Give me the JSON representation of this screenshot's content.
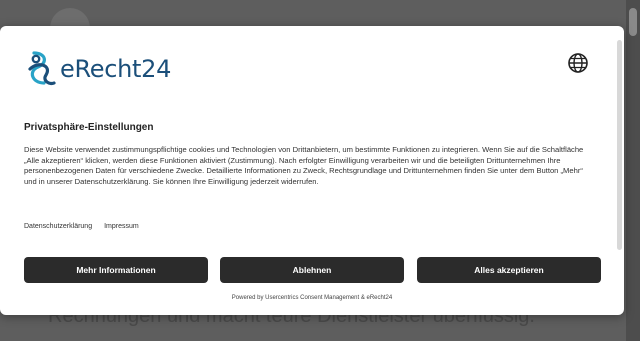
{
  "background": {
    "partial_text": "Rechnungen und macht teure Dienstleister überflüssig."
  },
  "modal": {
    "logo_text": "eRecht24",
    "language_icon": "globe-icon",
    "title": "Privatsphäre-Einstellungen",
    "description": "Diese Website verwendet zustimmungspflichtige cookies und Technologien von Drittanbietern, um bestimmte Funktionen zu integrieren. Wenn Sie auf die Schaltfläche „Alle akzeptieren“ klicken, werden diese Funktionen aktiviert (Zustimmung). Nach erfolgter Einwilligung verarbeiten wir und die beteiligten Drittunternehmen Ihre personenbezogenen Daten für verschiedene Zwecke. Detaillierte Informationen zu Zweck, Rechtsgrundlage und Drittunternehmen finden Sie unter dem Button „Mehr“ und in unserer Datenschutzerklärung. Sie können Ihre Einwilligung jederzeit widerrufen.",
    "links": {
      "privacy": "Datenschutzerklärung",
      "imprint": "Impressum"
    },
    "buttons": {
      "more": "Mehr Informationen",
      "deny": "Ablehnen",
      "accept": "Alles akzeptieren"
    },
    "powered_by": "Powered by Usercentrics Consent Management & eRecht24"
  },
  "colors": {
    "brand": "#1b4f7a",
    "brand_accent": "#29a3c7",
    "button": "#2b2b2b",
    "overlay": "#5e5e5e"
  }
}
